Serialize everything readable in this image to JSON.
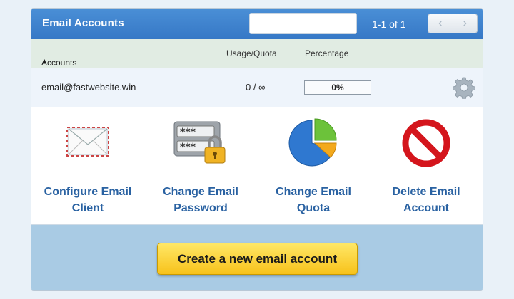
{
  "header": {
    "title": "Email Accounts",
    "search_placeholder": "",
    "pager_text": "1-1 of 1",
    "prev_label": "‹",
    "next_label": "›"
  },
  "columns": {
    "accounts": "Accounts",
    "sort_indicator": "▲",
    "usage": "Usage/Quota",
    "percentage": "Percentage"
  },
  "rows": [
    {
      "email": "email@fastwebsite.win",
      "usage": "0 / ∞",
      "percentage": "0%",
      "percentage_value": 0
    }
  ],
  "actions": [
    {
      "label_line1": "Configure Email",
      "label_line2": "Client",
      "icon": "envelope-icon"
    },
    {
      "label_line1": "Change Email",
      "label_line2": "Password",
      "icon": "password-lock-icon"
    },
    {
      "label_line1": "Change Email",
      "label_line2": "Quota",
      "icon": "pie-chart-icon"
    },
    {
      "label_line1": "Delete Email",
      "label_line2": "Account",
      "icon": "prohibited-icon"
    }
  ],
  "footer": {
    "create_label": "Create a new email account"
  },
  "colors": {
    "header_blue": "#3678c6",
    "column_header_bg": "#e1ece3",
    "row_bg": "#eef4fb",
    "action_label": "#2a62a2",
    "footer_bg": "#a9cbe4",
    "create_button": "#f7c21b",
    "delete_red": "#d4151c"
  }
}
